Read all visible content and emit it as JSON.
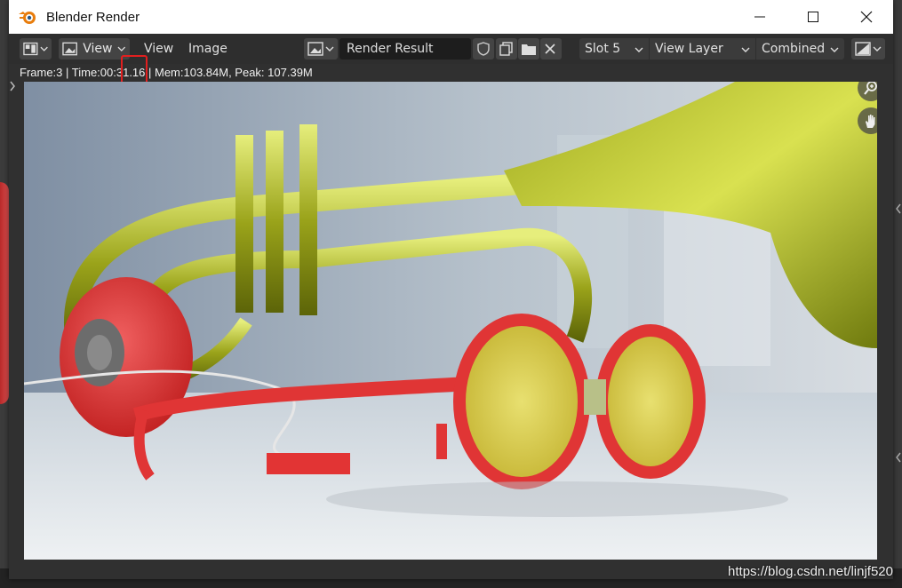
{
  "window": {
    "title": "Blender Render"
  },
  "header": {
    "menus": {
      "view_dropdown": "View",
      "view": "View",
      "image": "Image"
    },
    "image_name": "Render Result",
    "slot": "Slot 5",
    "view_layer": "View Layer",
    "pass": "Combined"
  },
  "info": {
    "stats": "Frame:3 | Time:00:31.16 | Mem:103.84M, Peak: 107.39M"
  },
  "watermark": "https://blog.csdn.net/linjf520",
  "colors": {
    "accent": "#e21f1f",
    "header_bg": "#2e2e2e",
    "field_bg": "#1d1d1d",
    "brass": "#a8b321",
    "red_object": "#e03535"
  },
  "icons": [
    "blender-logo-icon",
    "minimize-icon",
    "maximize-icon",
    "close-icon",
    "editor-type-icon",
    "image-mode-icon",
    "image-browse-icon",
    "fake-user-shield-icon",
    "new-image-icon",
    "open-folder-icon",
    "unlink-x-icon",
    "display-channels-icon",
    "zoom-icon",
    "hand-pan-icon"
  ]
}
